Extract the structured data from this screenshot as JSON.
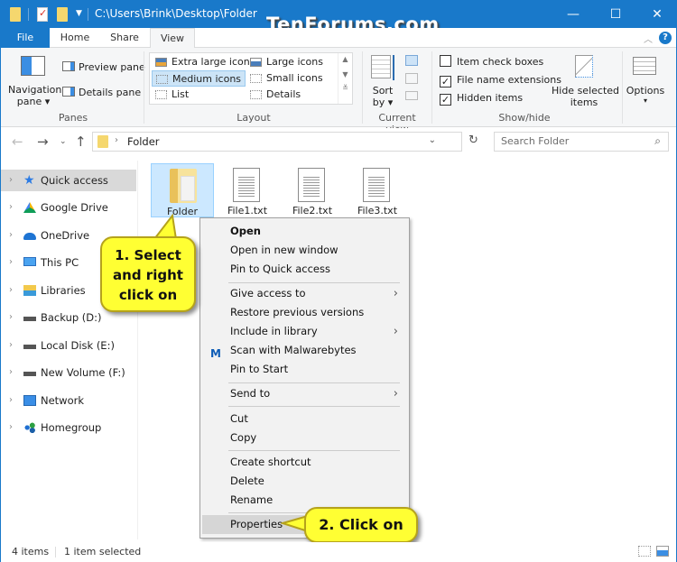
{
  "titlebar": {
    "path": "C:\\Users\\Brink\\Desktop\\Folder",
    "watermark": "TenForums.com",
    "minimize": "—",
    "maximize": "☐",
    "close": "✕"
  },
  "tabs": [
    {
      "label": "File"
    },
    {
      "label": "Home"
    },
    {
      "label": "Share"
    },
    {
      "label": "View"
    }
  ],
  "ribbon": {
    "panes": {
      "navigation_pane": "Navigation",
      "navigation_pane_2": "pane ▾",
      "preview_pane": "Preview pane",
      "details_pane": "Details pane",
      "group_label": "Panes"
    },
    "layout": {
      "items": [
        {
          "label": "Extra large icons"
        },
        {
          "label": "Large icons"
        },
        {
          "label": "Medium icons",
          "selected": true
        },
        {
          "label": "Small icons"
        },
        {
          "label": "List"
        },
        {
          "label": "Details"
        }
      ],
      "group_label": "Layout"
    },
    "current_view": {
      "sort_by": "Sort",
      "sort_by_2": "by ▾",
      "group_label": "Current view"
    },
    "show_hide": {
      "item_check_boxes": {
        "label": "Item check boxes",
        "checked": false
      },
      "file_name_extensions": {
        "label": "File name extensions",
        "checked": true
      },
      "hidden_items": {
        "label": "Hidden items",
        "checked": true
      },
      "hide_selected": "Hide selected",
      "hide_selected_2": "items",
      "group_label": "Show/hide"
    },
    "options": {
      "label": "Options",
      "arrow": "▾"
    }
  },
  "address": {
    "path_segment": "Folder",
    "search_placeholder": "Search Folder"
  },
  "nav": {
    "items": [
      {
        "label": "Quick access",
        "selected": true
      },
      {
        "label": "Google Drive"
      },
      {
        "label": "OneDrive"
      },
      {
        "label": "This PC"
      },
      {
        "label": "Libraries"
      },
      {
        "label": "Backup (D:)"
      },
      {
        "label": "Local Disk (E:)"
      },
      {
        "label": "New Volume (F:)"
      },
      {
        "label": "Network"
      },
      {
        "label": "Homegroup"
      }
    ]
  },
  "files": [
    {
      "name": "Folder",
      "type": "folder",
      "selected": true
    },
    {
      "name": "File1.txt",
      "type": "txt"
    },
    {
      "name": "File2.txt",
      "type": "txt"
    },
    {
      "name": "File3.txt",
      "type": "txt"
    }
  ],
  "context_menu": {
    "items": [
      {
        "label": "Open"
      },
      {
        "label": "Open in new window"
      },
      {
        "label": "Pin to Quick access"
      },
      {
        "label": "Give access to"
      },
      {
        "label": "Restore previous versions"
      },
      {
        "label": "Include in library"
      },
      {
        "label": "Scan with Malwarebytes"
      },
      {
        "label": "Pin to Start"
      },
      {
        "label": "Send to"
      },
      {
        "label": "Cut"
      },
      {
        "label": "Copy"
      },
      {
        "label": "Create shortcut"
      },
      {
        "label": "Delete"
      },
      {
        "label": "Rename"
      },
      {
        "label": "Properties"
      }
    ]
  },
  "callouts": {
    "step1_line1": "1. Select",
    "step1_line2": "and right",
    "step1_line3": "click on",
    "step2": "2. Click on"
  },
  "status": {
    "item_count": "4 items",
    "selected_count": "1 item selected"
  },
  "colors": {
    "accent": "#1979ca",
    "selection": "#cce8ff",
    "callout": "#ffff33"
  }
}
